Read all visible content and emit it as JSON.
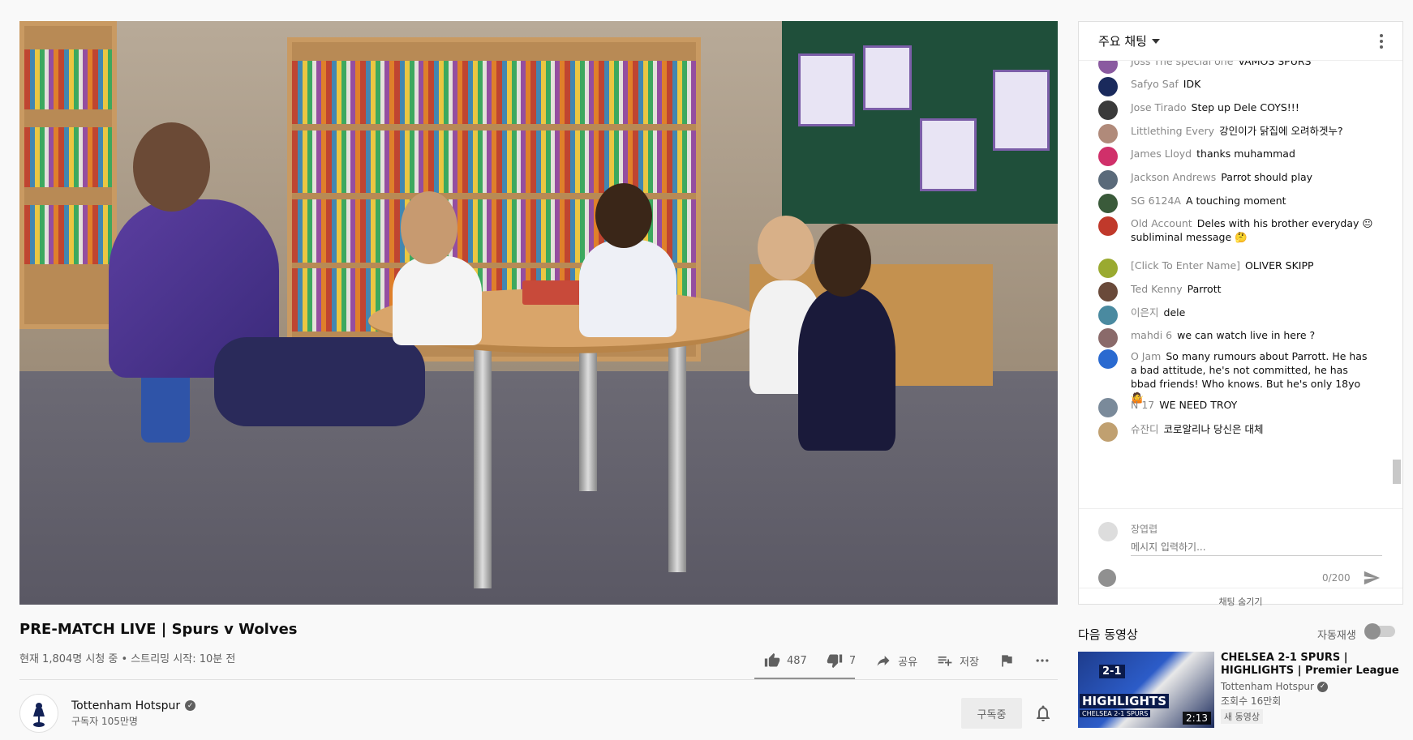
{
  "video": {
    "title": "PRE-MATCH LIVE | Spurs v Wolves",
    "meta": "현재 1,804명 시청 중 • 스트리밍 시작: 10분 전",
    "likes": "487",
    "dislikes": "7",
    "share_label": "공유",
    "save_label": "저장"
  },
  "channel": {
    "name": "Tottenham Hotspur",
    "subscribers": "구독자 105만명",
    "subscribe_label": "구독중"
  },
  "chat": {
    "header": "주요 채팅",
    "messages": [
      {
        "author": "Joss The special one",
        "text": "VAMOS SPURS",
        "color": "#8a5aa0"
      },
      {
        "author": "Safyo Saf",
        "text": "IDK",
        "color": "#1a2a5c"
      },
      {
        "author": "Jose Tirado",
        "text": "Step up Dele COYS!!!",
        "color": "#3a3a3a"
      },
      {
        "author": "Littlething Every",
        "text": "강인이가 닭집에 오려하겟누?",
        "color": "#b08a7a"
      },
      {
        "author": "James Lloyd",
        "text": "thanks muhammad",
        "color": "#d0306a"
      },
      {
        "author": "Jackson Andrews",
        "text": "Parrot should play",
        "color": "#5a6a7a"
      },
      {
        "author": "SG 6124A",
        "text": "A touching moment",
        "color": "#3a5a3a"
      },
      {
        "author": "Old Account",
        "text": "Deles with his brother everyday 😐 subliminal message 🤔",
        "color": "#c0392b"
      },
      {
        "author": "[Click To Enter Name]",
        "text": "OLIVER SKIPP",
        "color": "#9aaa30"
      },
      {
        "author": "Ted Kenny",
        "text": "Parrott",
        "color": "#6a4a3a"
      },
      {
        "author": "이은지",
        "text": "dele",
        "color": "#4a8aa0"
      },
      {
        "author": "mahdi 6",
        "text": "we can watch live in here ?",
        "color": "#8a6a6a"
      },
      {
        "author": "O Jam",
        "text": "So many rumours about Parrott. He has a bad attitude, he's not committed, he has bbad friends! Who knows. But he's only 18yo 🤷",
        "color": "#2a6ad0"
      },
      {
        "author": "N 17",
        "text": "WE NEED TROY",
        "color": "#7a8a9a"
      },
      {
        "author": "슈잔디",
        "text": "코로알리나 당신은 대체",
        "color": "#c0a070"
      }
    ],
    "input_name": "장엽렵",
    "input_placeholder": "메시지 입력하기...",
    "char_count": "0/200",
    "hide_label": "채팅 숨기기"
  },
  "upnext": {
    "heading": "다음 동영상",
    "autoplay_label": "자동재생",
    "autoplay_on": false,
    "title": "CHELSEA 2-1 SPURS | HIGHLIGHTS | Premier League",
    "channel": "Tottenham Hotspur",
    "views": "조회수 16만회",
    "badge": "새 동영상",
    "duration": "2:13",
    "thumb_score": "2-1",
    "thumb_highlights": "HIGHLIGHTS",
    "thumb_sub": "CHELSEA 2-1 SPURS"
  }
}
